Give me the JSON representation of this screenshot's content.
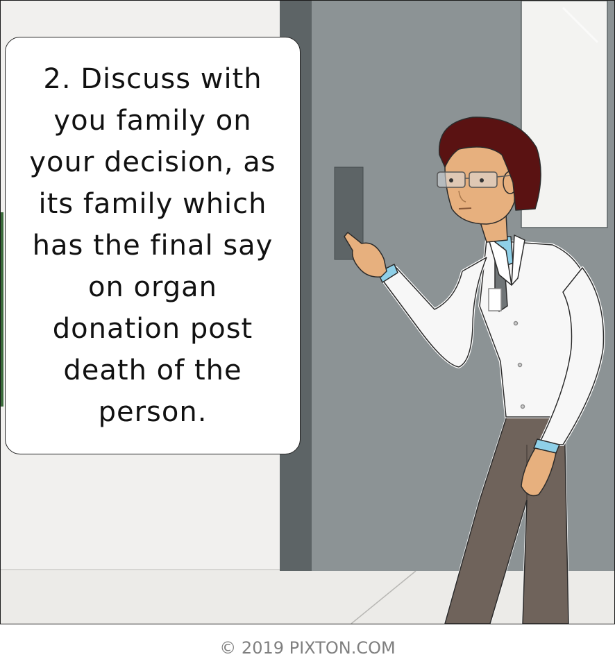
{
  "speech_bubble": {
    "text": "2. Discuss with you family on your decision, as its family which has the final say on organ donation post death of the person."
  },
  "credit": {
    "text": "© 2019 PIXTON.COM"
  },
  "colors": {
    "wall": "#f1f0ee",
    "door": "#8c9395",
    "door_frame": "#5d6466",
    "lab_coat": "#f7f7f7",
    "hair": "#5a1212",
    "trousers": "#6f635b",
    "shirt": "#8fd0e8"
  }
}
